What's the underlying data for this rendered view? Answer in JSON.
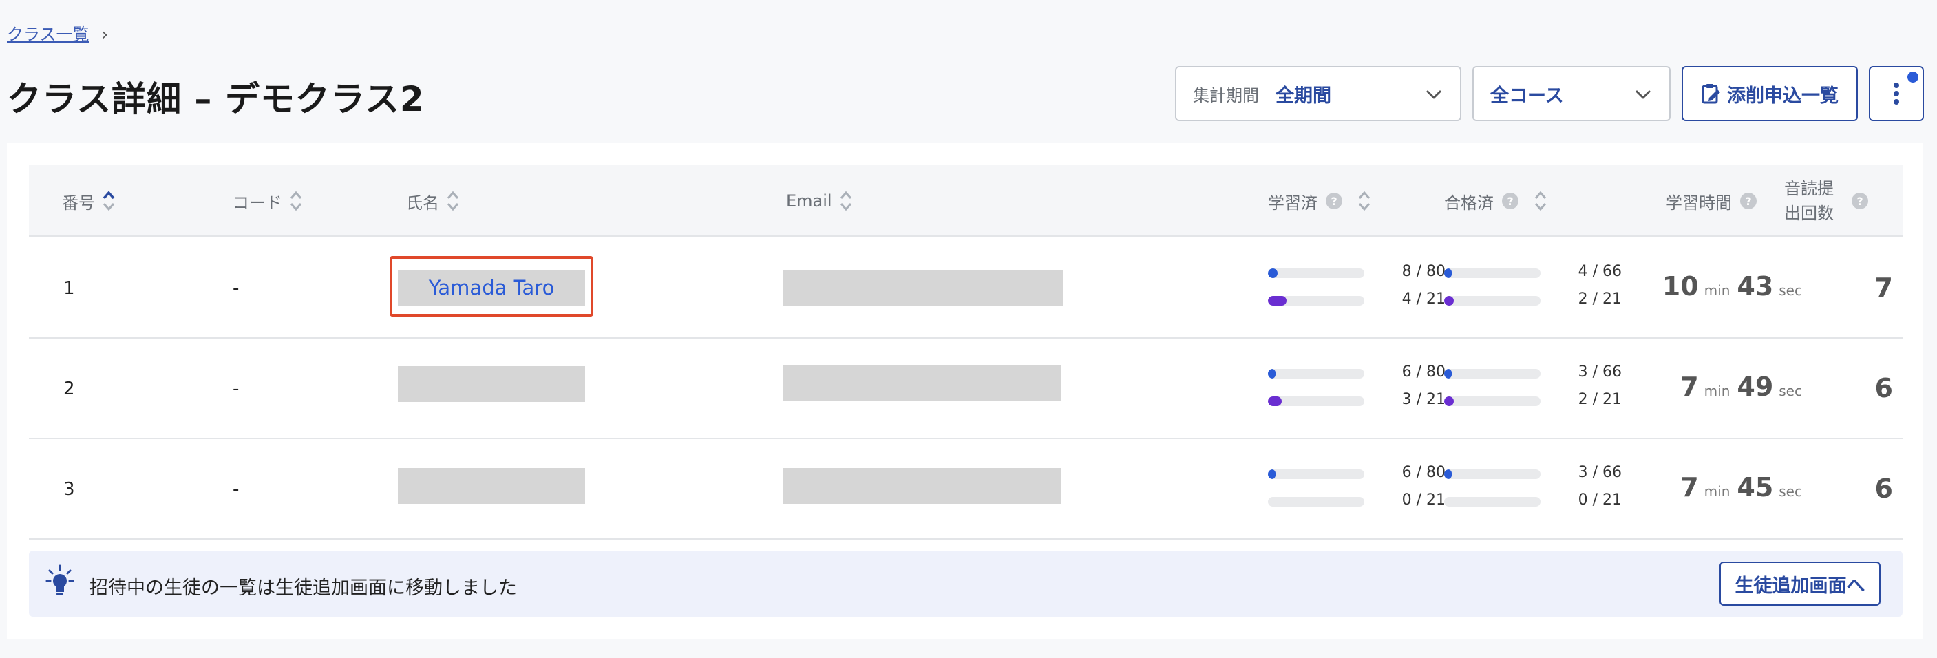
{
  "breadcrumb": {
    "link": "クラス一覧",
    "sep": "›"
  },
  "page": {
    "title": "クラス詳細 – デモクラス2"
  },
  "toolbar": {
    "period_label": "集計期間",
    "period_value": "全期間",
    "course_value": "全コース",
    "corrections_label": "添削申込一覧"
  },
  "table": {
    "headers": {
      "number": "番号",
      "code": "コード",
      "name": "氏名",
      "email": "Email",
      "studied": "学習済",
      "passed": "合格済",
      "study_time": "学習時間",
      "reading_line1": "音読提",
      "reading_line2": "出回数"
    },
    "rows": [
      {
        "number": "1",
        "code": "-",
        "name": "Yamada Taro",
        "studied": [
          {
            "text": "8 / 80",
            "frac": 0.1
          },
          {
            "text": "4 / 21",
            "frac": 0.19
          }
        ],
        "passed": [
          {
            "text": "4 / 66",
            "frac": 0.06
          },
          {
            "text": "2 / 21",
            "frac": 0.1
          }
        ],
        "minutes": "10",
        "seconds": "43",
        "min_unit": "min",
        "sec_unit": "sec",
        "reading_count": "7"
      },
      {
        "number": "2",
        "code": "-",
        "name": "",
        "studied": [
          {
            "text": "6 / 80",
            "frac": 0.075
          },
          {
            "text": "3 / 21",
            "frac": 0.14
          }
        ],
        "passed": [
          {
            "text": "3 / 66",
            "frac": 0.045
          },
          {
            "text": "2 / 21",
            "frac": 0.1
          }
        ],
        "minutes": "7",
        "seconds": "49",
        "min_unit": "min",
        "sec_unit": "sec",
        "reading_count": "6"
      },
      {
        "number": "3",
        "code": "-",
        "name": "",
        "studied": [
          {
            "text": "6 / 80",
            "frac": 0.075
          },
          {
            "text": "0 / 21",
            "frac": 0
          }
        ],
        "passed": [
          {
            "text": "3 / 66",
            "frac": 0.045
          },
          {
            "text": "0 / 21",
            "frac": 0
          }
        ],
        "minutes": "7",
        "seconds": "45",
        "min_unit": "min",
        "sec_unit": "sec",
        "reading_count": "6"
      }
    ]
  },
  "notice": {
    "text": "招待中の生徒の一覧は生徒追加画面に移動しました",
    "button": "生徒追加画面へ"
  },
  "colors": {
    "accent": "#2a4aa0",
    "bar_blue": "#2a5bd7",
    "bar_purple": "#6a2ed1",
    "highlight": "#e0482a"
  }
}
